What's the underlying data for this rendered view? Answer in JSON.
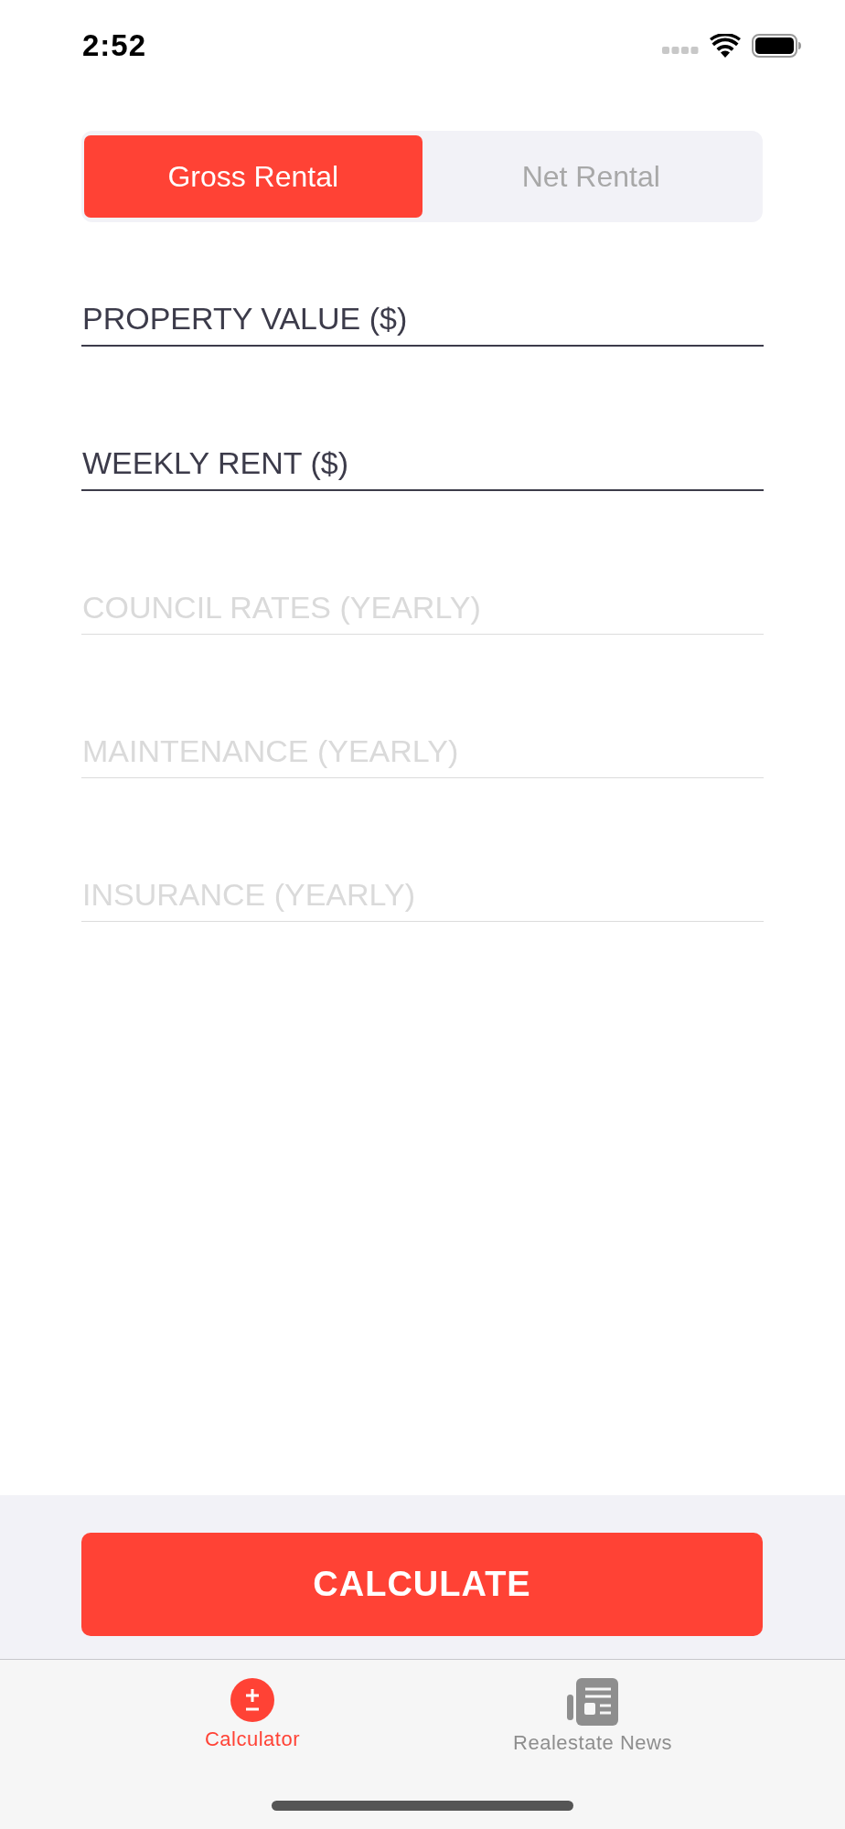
{
  "status_bar": {
    "time": "2:52"
  },
  "segmented_control": [
    {
      "label": "Gross Rental",
      "selected": true
    },
    {
      "label": "Net Rental",
      "selected": false
    }
  ],
  "fields": [
    {
      "placeholder": "PROPERTY VALUE ($)",
      "disabled": false
    },
    {
      "placeholder": "WEEKLY RENT ($)",
      "disabled": false
    },
    {
      "placeholder": "COUNCIL RATES (YEARLY)",
      "disabled": true
    },
    {
      "placeholder": "MAINTENANCE (YEARLY)",
      "disabled": true
    },
    {
      "placeholder": "INSURANCE (YEARLY)",
      "disabled": true
    }
  ],
  "action_button": {
    "label": "CALCULATE"
  },
  "tab_bar": [
    {
      "label": "Calculator",
      "kind": "calculator",
      "selected": true
    },
    {
      "label": "Realestate News",
      "kind": "news",
      "selected": false
    }
  ]
}
